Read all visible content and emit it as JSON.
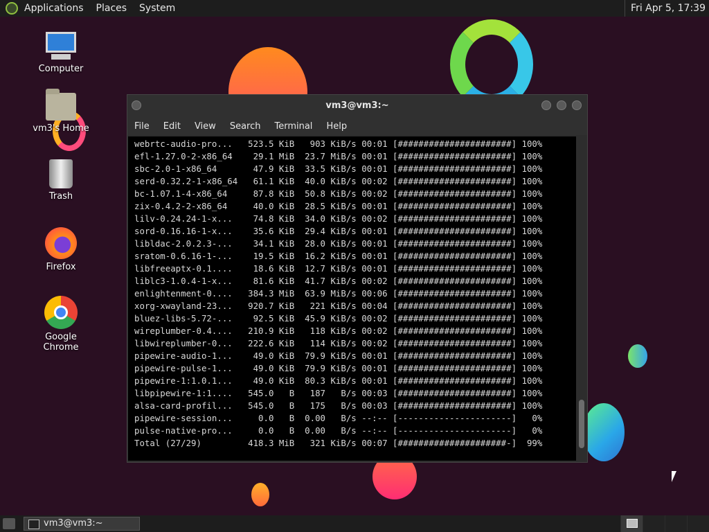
{
  "top_panel": {
    "menus": [
      "Applications",
      "Places",
      "System"
    ],
    "clock": "Fri Apr  5, 17:39"
  },
  "desktop_icons": [
    {
      "label": "Computer",
      "icon": "computer-icon"
    },
    {
      "label": "vm3's Home",
      "icon": "home-folder-icon"
    },
    {
      "label": "Trash",
      "icon": "trash-icon"
    },
    {
      "label": "Firefox",
      "icon": "firefox-icon"
    },
    {
      "label": "Google Chrome",
      "icon": "chrome-icon"
    }
  ],
  "terminal": {
    "title": "vm3@vm3:~",
    "menus": [
      "File",
      "Edit",
      "View",
      "Search",
      "Terminal",
      "Help"
    ],
    "lines": [
      "webrtc-audio-pro...   523.5 KiB   903 KiB/s 00:01 [######################] 100%",
      "efl-1.27.0-2-x86_64    29.1 MiB  23.7 MiB/s 00:01 [######################] 100%",
      "sbc-2.0-1-x86_64       47.9 KiB  33.5 KiB/s 00:01 [######################] 100%",
      "serd-0.32.2-1-x86_64   61.1 KiB  40.0 KiB/s 00:02 [######################] 100%",
      "bc-1.07.1-4-x86_64     87.8 KiB  50.8 KiB/s 00:02 [######################] 100%",
      "zix-0.4.2-2-x86_64     40.0 KiB  28.5 KiB/s 00:01 [######################] 100%",
      "lilv-0.24.24-1-x...    74.8 KiB  34.0 KiB/s 00:02 [######################] 100%",
      "sord-0.16.16-1-x...    35.6 KiB  29.4 KiB/s 00:01 [######################] 100%",
      "libldac-2.0.2.3-...    34.1 KiB  28.0 KiB/s 00:01 [######################] 100%",
      "sratom-0.6.16-1-...    19.5 KiB  16.2 KiB/s 00:01 [######################] 100%",
      "libfreeaptx-0.1....    18.6 KiB  12.7 KiB/s 00:01 [######################] 100%",
      "liblc3-1.0.4-1-x...    81.6 KiB  41.7 KiB/s 00:02 [######################] 100%",
      "enlightenment-0....   384.3 MiB  63.9 MiB/s 00:06 [######################] 100%",
      "xorg-xwayland-23...   920.7 KiB   221 KiB/s 00:04 [######################] 100%",
      "bluez-libs-5.72-...    92.5 KiB  45.9 KiB/s 00:02 [######################] 100%",
      "wireplumber-0.4....   210.9 KiB   118 KiB/s 00:02 [######################] 100%",
      "libwireplumber-0...   222.6 KiB   114 KiB/s 00:02 [######################] 100%",
      "pipewire-audio-1...    49.0 KiB  79.9 KiB/s 00:01 [######################] 100%",
      "pipewire-pulse-1...    49.0 KiB  79.9 KiB/s 00:01 [######################] 100%",
      "pipewire-1:1.0.1...    49.0 KiB  80.3 KiB/s 00:01 [######################] 100%",
      "libpipewire-1:1....   545.0   B   187   B/s 00:03 [######################] 100%",
      "alsa-card-profil...   545.0   B   175   B/s 00:03 [######################] 100%",
      "pipewire-session...     0.0   B  0.00   B/s --:-- [----------------------]   0%",
      "pulse-native-pro...     0.0   B  0.00   B/s --:-- [----------------------]   0%",
      "Total (27/29)         418.3 MiB   321 KiB/s 00:07 [#####################-]  99%"
    ]
  },
  "taskbar": {
    "task_label": "vm3@vm3:~"
  }
}
